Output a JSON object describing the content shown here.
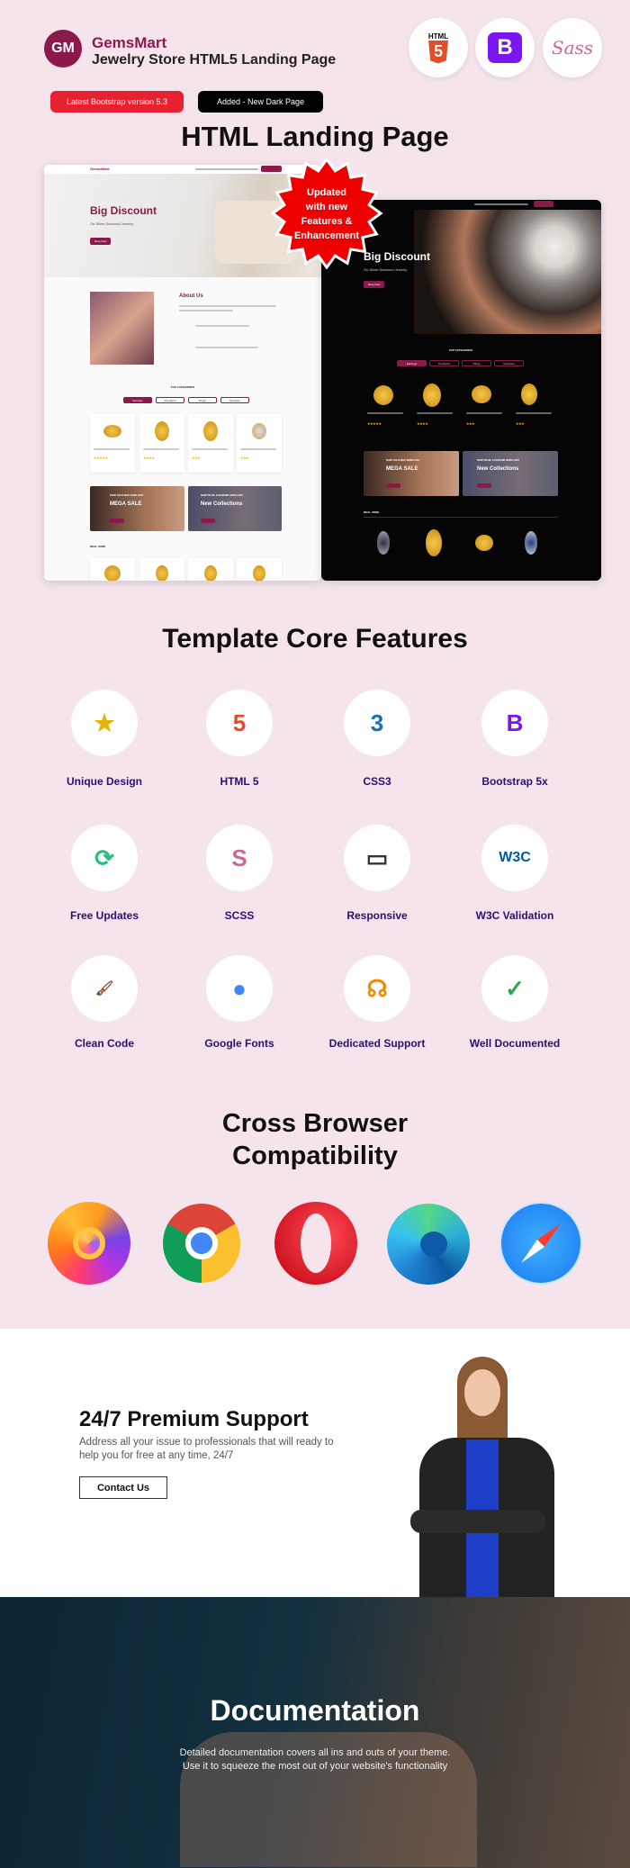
{
  "header": {
    "logo_initials": "GM",
    "brand": "GemsMart",
    "subtitle": "Jewelry Store HTML5 Landing Page",
    "tech_icons": [
      "html5-icon",
      "bootstrap-icon",
      "sass-icon"
    ],
    "tech_icon_text": {
      "html": "HTML",
      "html_num": "5",
      "bootstrap": "B",
      "sass": "Sass"
    }
  },
  "badges": {
    "bootstrap": "Latest Bootstrap version 5.3",
    "dark": "Added - New Dark Page"
  },
  "landing": {
    "title": "HTML Landing Page",
    "starburst": [
      "Updated",
      "with new",
      "Features &",
      "Enhancement"
    ],
    "light": {
      "logo": "Gems♦Mart",
      "hero_title": "Big Discount",
      "hero_sub": "On Silver Diamond Jewelry",
      "shop_btn": "Shop Now",
      "about_title": "About Us",
      "categories_title": "TOP CATEGORIES",
      "tabs": [
        "Earrings",
        "Pendants",
        "Rings",
        "Necklace"
      ],
      "banner1_small": "SHOP GOLD NEW JEWELLERY",
      "banner1_title": "MEGA SALE",
      "banner2_small": "SHOP PEARL & DIAMOND JEWELLERY",
      "banner2_title": "New Collections",
      "deal_title": "DEAL ZONE"
    },
    "dark": {
      "hero_title": "Big Discount",
      "hero_sub": "On Silver Diamond Jewelry",
      "shop_btn": "Shop Now",
      "categories_title": "TOP CATEGORIES",
      "tabs": [
        "Earrings",
        "Pendants",
        "Rings",
        "Necklace"
      ],
      "banner1_small": "SHOP GOLD NEW JEWELLERY",
      "banner1_title": "MEGA SALE",
      "banner2_small": "SHOP PEARL & DIAMOND JEWELLERY",
      "banner2_title": "New Collections",
      "deal_title": "DEAL ZONE"
    }
  },
  "features": {
    "title": "Template Core Features",
    "items": [
      {
        "label": "Unique Design",
        "icon": "unique-design-icon"
      },
      {
        "label": "HTML 5",
        "icon": "html5-icon"
      },
      {
        "label": "CSS3",
        "icon": "css3-icon"
      },
      {
        "label": "Bootstrap 5x",
        "icon": "bootstrap-icon"
      },
      {
        "label": "Free Updates",
        "icon": "free-updates-icon"
      },
      {
        "label": "SCSS",
        "icon": "sass-icon"
      },
      {
        "label": "Responsive",
        "icon": "responsive-devices-icon"
      },
      {
        "label": "W3C Validation",
        "icon": "w3c-icon"
      },
      {
        "label": "Clean Code",
        "icon": "broom-icon"
      },
      {
        "label": "Google Fonts",
        "icon": "google-fonts-icon"
      },
      {
        "label": "Dedicated Support",
        "icon": "headset-icon"
      },
      {
        "label": "Well Documented",
        "icon": "document-stamp-icon"
      }
    ]
  },
  "browsers": {
    "title_line1": "Cross Browser",
    "title_line2": "Compatibility",
    "items": [
      "firefox-icon",
      "chrome-icon",
      "opera-icon",
      "edge-icon",
      "safari-icon"
    ]
  },
  "support": {
    "title": "24/7 Premium Support",
    "text_line1": "Address all your issue to professionals that will ready to",
    "text_line2": "help you for free at any time, 24/7",
    "button": "Contact Us"
  },
  "documentation": {
    "title": "Documentation",
    "text_line1": "Detailed documentation covers all ins and outs of your theme.",
    "text_line2": "Use it to squeeze the most out of your website's functionality"
  },
  "colors": {
    "bg_pink": "#f5e4ec",
    "brand": "#8b1a4a",
    "feature_label": "#2a1070",
    "badge_red": "#e8202f"
  }
}
